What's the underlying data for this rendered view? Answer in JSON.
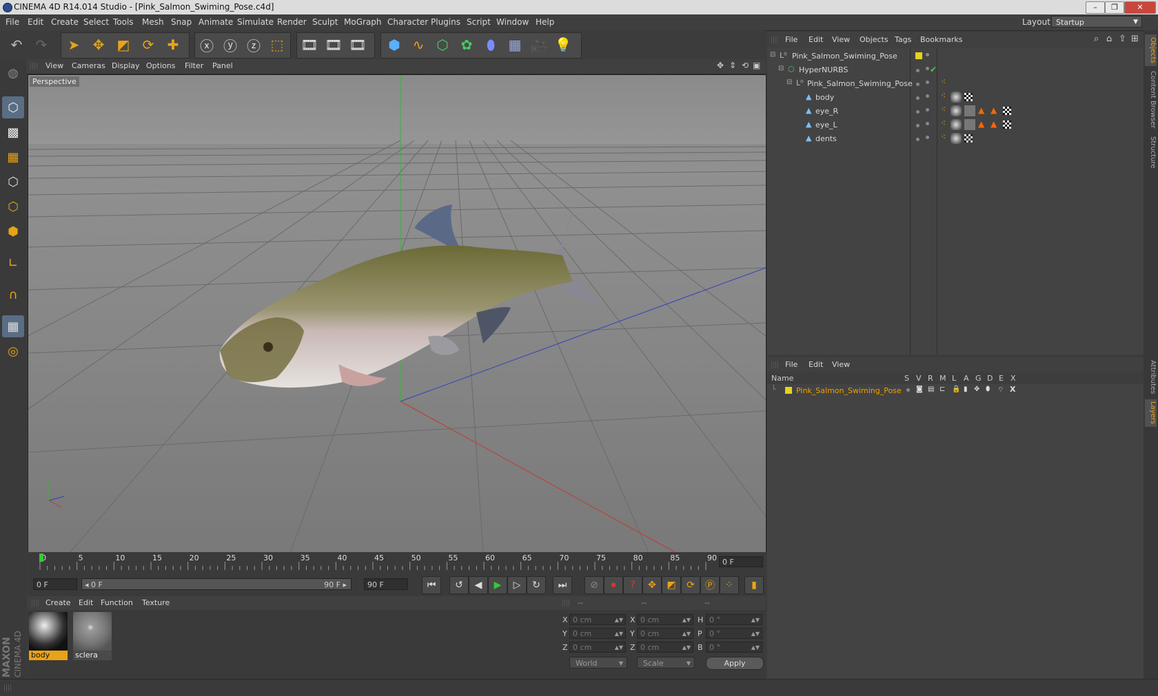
{
  "window": {
    "title": "CINEMA 4D R14.014 Studio - [Pink_Salmon_Swiming_Pose.c4d]",
    "controls": [
      "–",
      "❐",
      "✕"
    ]
  },
  "menubar": {
    "items": [
      "File",
      "Edit",
      "Create",
      "Select",
      "Tools",
      "Mesh",
      "Snap",
      "Animate",
      "Simulate",
      "Render",
      "Sculpt",
      "MoGraph",
      "Character",
      "Plugins",
      "Script",
      "Window",
      "Help"
    ],
    "layout_label": "Layout:",
    "layout_value": "Startup"
  },
  "viewport": {
    "menu": [
      "View",
      "Cameras",
      "Display",
      "Options",
      "Filter",
      "Panel"
    ],
    "label": "Perspective"
  },
  "timeline": {
    "ticks": [
      "0",
      "5",
      "10",
      "15",
      "20",
      "25",
      "30",
      "35",
      "40",
      "45",
      "50",
      "55",
      "60",
      "65",
      "70",
      "75",
      "80",
      "85",
      "90"
    ],
    "current_frame": "0 F",
    "start_field": "0 F",
    "range_start": "◂ 0 F",
    "range_end": "90 F ▸",
    "end_field": "90 F"
  },
  "materials": {
    "menu": [
      "Create",
      "Edit",
      "Function",
      "Texture"
    ],
    "items": [
      {
        "name": "body",
        "selected": true
      },
      {
        "name": "sclera",
        "selected": false
      }
    ]
  },
  "coordinates": {
    "headers": [
      "--",
      "--",
      "--"
    ],
    "rows": [
      {
        "a": "X",
        "av": "0 cm",
        "b": "X",
        "bv": "0 cm",
        "c": "H",
        "cv": "0 °"
      },
      {
        "a": "Y",
        "av": "0 cm",
        "b": "Y",
        "bv": "0 cm",
        "c": "P",
        "cv": "0 °"
      },
      {
        "a": "Z",
        "av": "0 cm",
        "b": "Z",
        "bv": "0 cm",
        "c": "B",
        "cv": "0 °"
      }
    ],
    "mode_world": "World",
    "mode_scale": "Scale",
    "apply": "Apply"
  },
  "objects": {
    "menu": [
      "File",
      "Edit",
      "View",
      "Objects",
      "Tags",
      "Bookmarks"
    ],
    "tree": [
      {
        "name": "Pink_Salmon_Swiming_Pose"
      },
      {
        "name": "HyperNURBS"
      },
      {
        "name": "Pink_Salmon_Swiming_Pose"
      },
      {
        "name": "body"
      },
      {
        "name": "eye_R"
      },
      {
        "name": "eye_L"
      },
      {
        "name": "dents"
      }
    ]
  },
  "layers": {
    "menu": [
      "File",
      "Edit",
      "View"
    ],
    "columns": [
      "Name",
      "S",
      "V",
      "R",
      "M",
      "L",
      "A",
      "G",
      "D",
      "E",
      "X"
    ],
    "rows": [
      {
        "name": "Pink_Salmon_Swiming_Pose",
        "color": "#e6d21e"
      }
    ]
  },
  "right_tabs": [
    "Objects",
    "Content Browser",
    "Structure",
    "Attributes",
    "Layers"
  ],
  "brand": {
    "maxon": "MAXON",
    "product": "CINEMA 4D"
  },
  "colors": {
    "accent": "#e8a317",
    "selection": "#f0a000",
    "layer_yellow": "#e6d21e"
  }
}
